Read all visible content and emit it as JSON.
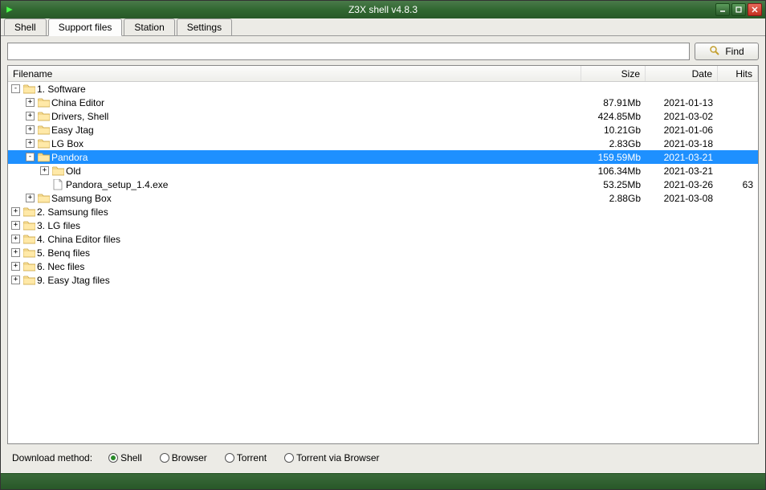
{
  "window": {
    "title": "Z3X shell v4.8.3"
  },
  "tabs": {
    "t0": "Shell",
    "t1": "Support files",
    "t2": "Station",
    "t3": "Settings",
    "active": 1
  },
  "search": {
    "value": "",
    "find_label": "Find"
  },
  "columns": {
    "name": "Filename",
    "size": "Size",
    "date": "Date",
    "hits": "Hits"
  },
  "tree": [
    {
      "indent": 0,
      "expand": "-",
      "icon": "folder",
      "name": "1. Software",
      "size": "",
      "date": "",
      "hits": "",
      "selected": false
    },
    {
      "indent": 1,
      "expand": "+",
      "icon": "folder",
      "name": "China Editor",
      "size": "87.91Mb",
      "date": "2021-01-13",
      "hits": "",
      "selected": false
    },
    {
      "indent": 1,
      "expand": "+",
      "icon": "folder",
      "name": "Drivers, Shell",
      "size": "424.85Mb",
      "date": "2021-03-02",
      "hits": "",
      "selected": false
    },
    {
      "indent": 1,
      "expand": "+",
      "icon": "folder",
      "name": "Easy Jtag",
      "size": "10.21Gb",
      "date": "2021-01-06",
      "hits": "",
      "selected": false
    },
    {
      "indent": 1,
      "expand": "+",
      "icon": "folder",
      "name": "LG Box",
      "size": "2.83Gb",
      "date": "2021-03-18",
      "hits": "",
      "selected": false
    },
    {
      "indent": 1,
      "expand": "-",
      "icon": "folder",
      "name": "Pandora",
      "size": "159.59Mb",
      "date": "2021-03-21",
      "hits": "",
      "selected": true
    },
    {
      "indent": 2,
      "expand": "+",
      "icon": "folder",
      "name": "Old",
      "size": "106.34Mb",
      "date": "2021-03-21",
      "hits": "",
      "selected": false
    },
    {
      "indent": 2,
      "expand": "",
      "icon": "file",
      "name": "Pandora_setup_1.4.exe",
      "size": "53.25Mb",
      "date": "2021-03-26",
      "hits": "63",
      "selected": false
    },
    {
      "indent": 1,
      "expand": "+",
      "icon": "folder",
      "name": "Samsung Box",
      "size": "2.88Gb",
      "date": "2021-03-08",
      "hits": "",
      "selected": false
    },
    {
      "indent": 0,
      "expand": "+",
      "icon": "folder",
      "name": "2. Samsung files",
      "size": "",
      "date": "",
      "hits": "",
      "selected": false
    },
    {
      "indent": 0,
      "expand": "+",
      "icon": "folder",
      "name": "3. LG files",
      "size": "",
      "date": "",
      "hits": "",
      "selected": false
    },
    {
      "indent": 0,
      "expand": "+",
      "icon": "folder",
      "name": "4. China Editor files",
      "size": "",
      "date": "",
      "hits": "",
      "selected": false
    },
    {
      "indent": 0,
      "expand": "+",
      "icon": "folder",
      "name": "5. Benq files",
      "size": "",
      "date": "",
      "hits": "",
      "selected": false
    },
    {
      "indent": 0,
      "expand": "+",
      "icon": "folder",
      "name": "6. Nec files",
      "size": "",
      "date": "",
      "hits": "",
      "selected": false
    },
    {
      "indent": 0,
      "expand": "+",
      "icon": "folder",
      "name": "9. Easy Jtag files",
      "size": "",
      "date": "",
      "hits": "",
      "selected": false
    }
  ],
  "footer": {
    "label": "Download method:",
    "opts": [
      "Shell",
      "Browser",
      "Torrent",
      "Torrent via Browser"
    ],
    "selected": 0
  }
}
